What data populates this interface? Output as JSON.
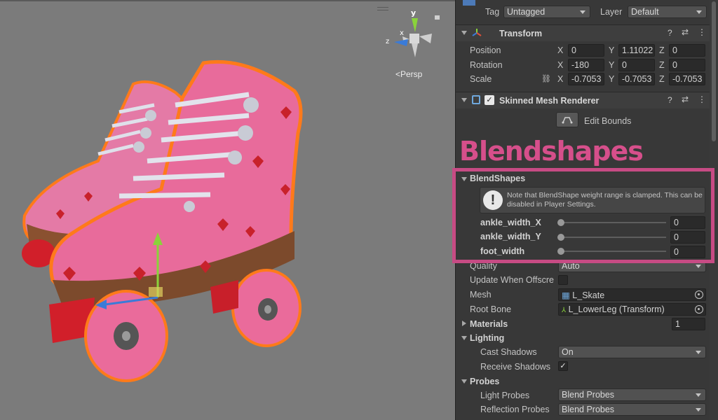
{
  "scene": {
    "persp_label": "<Persp",
    "gizmo_axes": {
      "y": "y",
      "x": "x",
      "z": "z"
    }
  },
  "inspector": {
    "tag_label": "Tag",
    "tag_value": "Untagged",
    "layer_label": "Layer",
    "layer_value": "Default",
    "transform": {
      "title": "Transform",
      "position_label": "Position",
      "rotation_label": "Rotation",
      "scale_label": "Scale",
      "position": {
        "x": "0",
        "y": "1.11022",
        "z": "0"
      },
      "rotation": {
        "x": "-180",
        "y": "0",
        "z": "0"
      },
      "scale": {
        "x": "-0.7053",
        "y": "-0.7053",
        "z": "-0.7053"
      },
      "axis_x": "X",
      "axis_y": "Y",
      "axis_z": "Z"
    },
    "skinned_mesh_renderer": {
      "title": "Skinned Mesh Renderer",
      "enabled": true,
      "edit_bounds_label": "Edit Bounds",
      "blendshapes_header": "BlendShapes",
      "blendshape_note": "Note that BlendShape weight range is clamped. This can be disabled in Player Settings.",
      "blendshapes": [
        {
          "name": "ankle_width_X",
          "value": "0"
        },
        {
          "name": "ankle_width_Y",
          "value": "0"
        },
        {
          "name": "foot_width",
          "value": "0"
        }
      ],
      "quality_label": "Quality",
      "quality_value": "Auto",
      "update_offscreen_label": "Update When Offscre",
      "mesh_label": "Mesh",
      "mesh_value": "L_Skate",
      "root_bone_label": "Root Bone",
      "root_bone_value": "L_LowerLeg (Transform)",
      "materials_label": "Materials",
      "materials_count": "1",
      "lighting_label": "Lighting",
      "cast_shadows_label": "Cast Shadows",
      "cast_shadows_value": "On",
      "receive_shadows_label": "Receive Shadows",
      "receive_shadows": true,
      "probes_label": "Probes",
      "light_probes_label": "Light Probes",
      "light_probes_value": "Blend Probes",
      "reflection_probes_label": "Reflection Probes",
      "reflection_probes_value": "Blend Probes"
    }
  },
  "overlay": {
    "title": "Blendshapes"
  },
  "colors": {
    "highlight": "#c74b84",
    "skate_pink": "#e96a9c",
    "wheel_pink": "#ea6b9b",
    "scene_bg": "#7b7b7b",
    "inspector_bg": "#383838"
  },
  "icons": [
    "lock-icon",
    "transform-icon",
    "skinned-mesh-icon",
    "help-icon",
    "presets-icon",
    "more-icon",
    "info-icon",
    "edit-bounds-icon",
    "mesh-icon",
    "bone-icon",
    "object-picker-icon",
    "constrain-proportions-icon"
  ]
}
